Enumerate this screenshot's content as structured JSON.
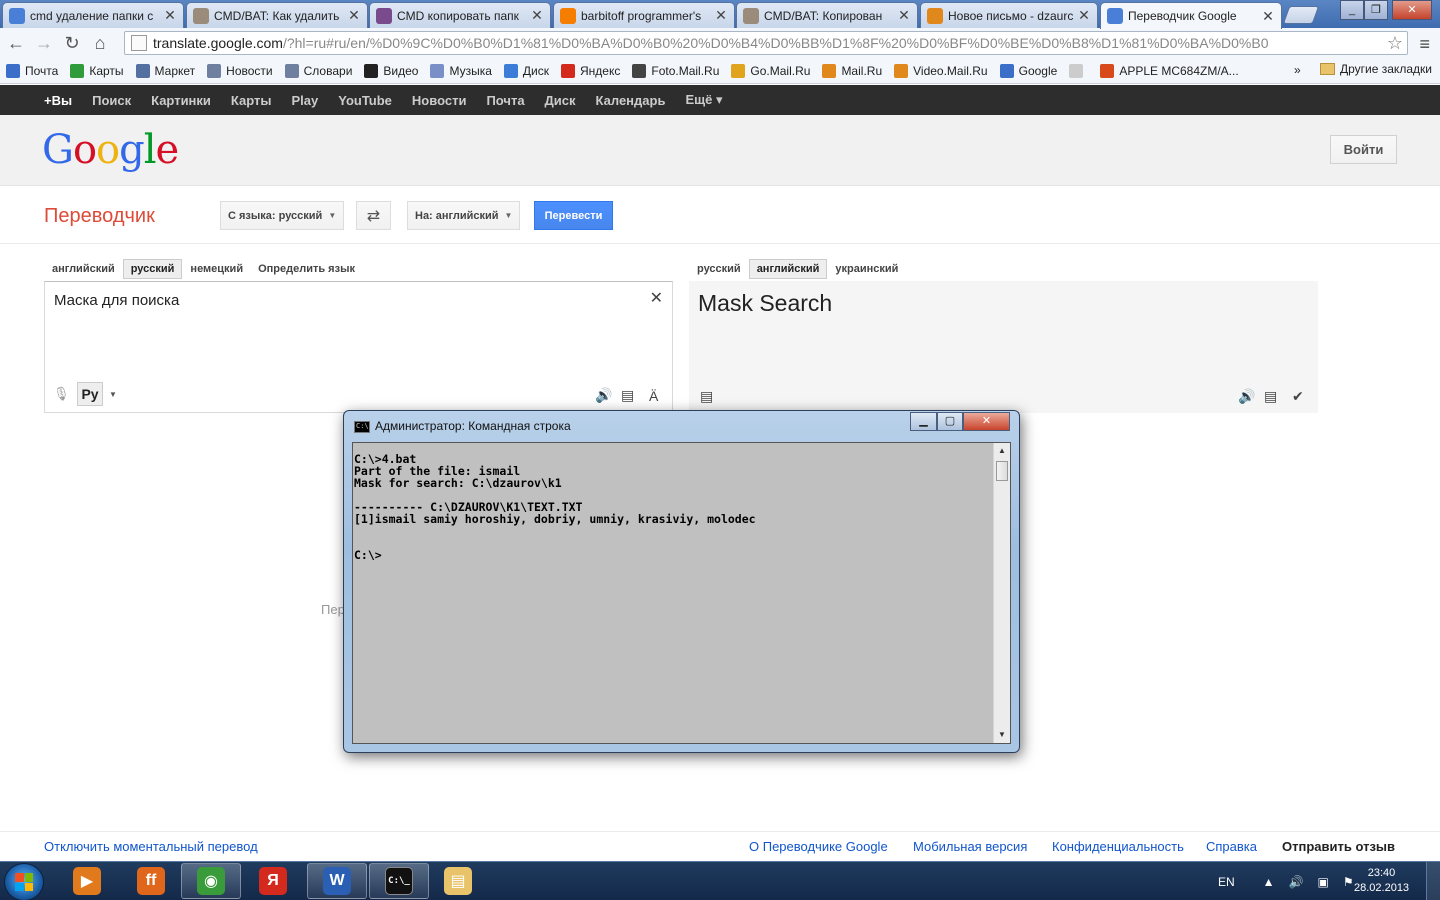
{
  "browser": {
    "tabs": [
      {
        "title": "cmd удаление папки с",
        "favicon": "google-icon",
        "color": "#4a7fd8",
        "active": false
      },
      {
        "title": "CMD/BAT: Как удалить",
        "favicon": "forum-icon",
        "color": "#9b8b7a",
        "active": false
      },
      {
        "title": "CMD копировать папк",
        "favicon": "ru-board-icon",
        "color": "#7a4b8c",
        "active": false
      },
      {
        "title": "barbitoff programmer's",
        "favicon": "blogger-icon",
        "color": "#f57d00",
        "active": false
      },
      {
        "title": "CMD/BAT: Копирован",
        "favicon": "forum-icon",
        "color": "#9b8b7a",
        "active": false
      },
      {
        "title": "Новое письмо - dzaurc",
        "favicon": "mail-ru-icon",
        "color": "#e0881c",
        "active": false
      },
      {
        "title": "Переводчик Google",
        "favicon": "google-translate-icon",
        "color": "#4a7fd8",
        "active": true
      }
    ],
    "url_host": "translate.google.com",
    "url_rest": "/?hl=ru#ru/en/%D0%9C%D0%B0%D1%81%D0%BA%D0%B0%20%D0%B4%D0%BB%D1%8F%20%D0%BF%D0%BE%D0%B8%D1%81%D0%BA%D0%B0",
    "bookmarks": [
      {
        "label": "Почта",
        "color": "#3b6ec8"
      },
      {
        "label": "Карты",
        "color": "#2f9b3a"
      },
      {
        "label": "Маркет",
        "color": "#5470a0"
      },
      {
        "label": "Новости",
        "color": "#6f7fa0"
      },
      {
        "label": "Словари",
        "color": "#6f7fa0"
      },
      {
        "label": "Видео",
        "color": "#222222"
      },
      {
        "label": "Музыка",
        "color": "#7a8fc8"
      },
      {
        "label": "Диск",
        "color": "#3c7dd8"
      },
      {
        "label": "Яндекс",
        "color": "#d42a1e"
      },
      {
        "label": "Foto.Mail.Ru",
        "color": "#444444"
      },
      {
        "label": "Go.Mail.Ru",
        "color": "#e0a51c"
      },
      {
        "label": "Mail.Ru",
        "color": "#e0881c"
      },
      {
        "label": "Video.Mail.Ru",
        "color": "#e0881c"
      },
      {
        "label": "Google",
        "color": "#3b6ec8"
      },
      {
        "label": "",
        "color": "#cccccc"
      },
      {
        "label": "APPLE MC684ZM/A...",
        "color": "#d84a1c"
      }
    ],
    "bookmarks_more": "»",
    "other_bookmarks": "Другие закладки"
  },
  "gbar": {
    "items": [
      "+Вы",
      "Поиск",
      "Картинки",
      "Карты",
      "Play",
      "YouTube",
      "Новости",
      "Почта",
      "Диск",
      "Календарь",
      "Ещё ▾"
    ]
  },
  "header": {
    "logo_letters": [
      {
        "ch": "G",
        "color": "#3369e8"
      },
      {
        "ch": "o",
        "color": "#d50f25"
      },
      {
        "ch": "o",
        "color": "#eeb211"
      },
      {
        "ch": "g",
        "color": "#3369e8"
      },
      {
        "ch": "l",
        "color": "#009925"
      },
      {
        "ch": "e",
        "color": "#d50f25"
      }
    ],
    "signin_label": "Войти"
  },
  "translate": {
    "app_title": "Переводчик",
    "from_label": "С языка: русский",
    "to_label": "На: английский",
    "translate_button": "Перевести",
    "source_tabs": [
      "английский",
      "русский",
      "немецкий",
      "Определить язык"
    ],
    "source_selected": 1,
    "target_tabs": [
      "русский",
      "английский",
      "украинский"
    ],
    "target_selected": 1,
    "source_text": "Маска для поиска",
    "ime_label": "Ру",
    "result_text": "Mask Search",
    "partial_hint": "Пер"
  },
  "footer": {
    "instant_off": "Отключить моментальный перевод",
    "about": "О Переводчике Google",
    "mobile": "Мобильная версия",
    "privacy": "Конфиденциальность",
    "help": "Справка",
    "feedback": "Отправить отзыв"
  },
  "cmd": {
    "title": "Администратор: Командная строка",
    "icon_text": "C:\\",
    "lines": [
      "C:\\>4.bat",
      "Part of the file: ismail",
      "Mask for search: C:\\dzaurov\\k1",
      "",
      "---------- C:\\DZAUROV\\K1\\TEXT.TXT",
      "[1]ismail samiy horoshiy, dobriy, umniy, krasiviy, molodec",
      "",
      "",
      "C:\\>"
    ]
  },
  "taskbar": {
    "apps": [
      {
        "name": "media-player-icon",
        "color": "#e07a1c",
        "text": "▶",
        "open": false
      },
      {
        "name": "firefox-icon",
        "color": "#e0661c",
        "text": "ff",
        "open": false
      },
      {
        "name": "chrome-icon",
        "color": "#3a9b3a",
        "text": "◉",
        "open": true
      },
      {
        "name": "yandex-browser-icon",
        "color": "#d42a1e",
        "text": "Я",
        "open": false
      },
      {
        "name": "word-icon",
        "color": "#2b5fb3",
        "text": "W",
        "open": true
      },
      {
        "name": "cmd-icon",
        "color": "#111111",
        "text": "C:\\_",
        "open": true
      },
      {
        "name": "explorer-icon",
        "color": "#e8c36a",
        "text": "▤",
        "open": false
      }
    ],
    "lang": "EN",
    "time": "23:40",
    "date": "28.02.2013"
  }
}
